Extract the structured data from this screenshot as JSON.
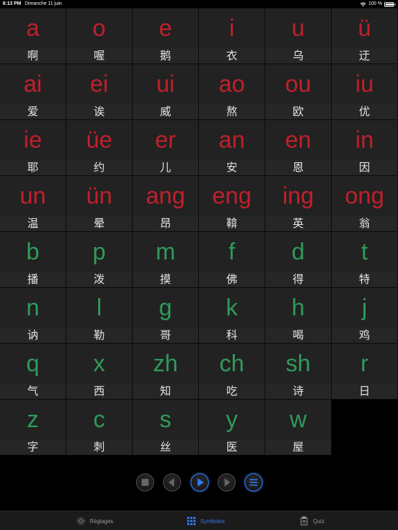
{
  "status_bar": {
    "time": "6:13 PM",
    "date": "Dimanche 11 juin",
    "battery": "100 %",
    "battery_level": 1.0
  },
  "colors": {
    "vowel": "#c0202b",
    "consonant": "#2f9a5a",
    "accent": "#2f7cf6"
  },
  "grid": {
    "rows": [
      [
        {
          "symbol": "a",
          "char": "啊",
          "kind": "vowel"
        },
        {
          "symbol": "o",
          "char": "喔",
          "kind": "vowel"
        },
        {
          "symbol": "e",
          "char": "鹅",
          "kind": "vowel"
        },
        {
          "symbol": "i",
          "char": "衣",
          "kind": "vowel"
        },
        {
          "symbol": "u",
          "char": "乌",
          "kind": "vowel"
        },
        {
          "symbol": "ü",
          "char": "迂",
          "kind": "vowel"
        }
      ],
      [
        {
          "symbol": "ai",
          "char": "爱",
          "kind": "vowel"
        },
        {
          "symbol": "ei",
          "char": "诶",
          "kind": "vowel"
        },
        {
          "symbol": "ui",
          "char": "威",
          "kind": "vowel"
        },
        {
          "symbol": "ao",
          "char": "熬",
          "kind": "vowel"
        },
        {
          "symbol": "ou",
          "char": "欧",
          "kind": "vowel"
        },
        {
          "symbol": "iu",
          "char": "优",
          "kind": "vowel"
        }
      ],
      [
        {
          "symbol": "ie",
          "char": "耶",
          "kind": "vowel"
        },
        {
          "symbol": "üe",
          "char": "约",
          "kind": "vowel"
        },
        {
          "symbol": "er",
          "char": "儿",
          "kind": "vowel"
        },
        {
          "symbol": "an",
          "char": "安",
          "kind": "vowel"
        },
        {
          "symbol": "en",
          "char": "恩",
          "kind": "vowel"
        },
        {
          "symbol": "in",
          "char": "因",
          "kind": "vowel"
        }
      ],
      [
        {
          "symbol": "un",
          "char": "温",
          "kind": "vowel"
        },
        {
          "symbol": "ün",
          "char": "晕",
          "kind": "vowel"
        },
        {
          "symbol": "ang",
          "char": "昂",
          "kind": "vowel"
        },
        {
          "symbol": "eng",
          "char": "鞥",
          "kind": "vowel"
        },
        {
          "symbol": "ing",
          "char": "英",
          "kind": "vowel"
        },
        {
          "symbol": "ong",
          "char": "翁",
          "kind": "vowel"
        }
      ],
      [
        {
          "symbol": "b",
          "char": "播",
          "kind": "consonant"
        },
        {
          "symbol": "p",
          "char": "泼",
          "kind": "consonant"
        },
        {
          "symbol": "m",
          "char": "摸",
          "kind": "consonant"
        },
        {
          "symbol": "f",
          "char": "佛",
          "kind": "consonant"
        },
        {
          "symbol": "d",
          "char": "得",
          "kind": "consonant"
        },
        {
          "symbol": "t",
          "char": "特",
          "kind": "consonant"
        }
      ],
      [
        {
          "symbol": "n",
          "char": "讷",
          "kind": "consonant"
        },
        {
          "symbol": "l",
          "char": "勒",
          "kind": "consonant"
        },
        {
          "symbol": "g",
          "char": "哥",
          "kind": "consonant"
        },
        {
          "symbol": "k",
          "char": "科",
          "kind": "consonant"
        },
        {
          "symbol": "h",
          "char": "喝",
          "kind": "consonant"
        },
        {
          "symbol": "j",
          "char": "鸡",
          "kind": "consonant"
        }
      ],
      [
        {
          "symbol": "q",
          "char": "气",
          "kind": "consonant"
        },
        {
          "symbol": "x",
          "char": "西",
          "kind": "consonant"
        },
        {
          "symbol": "zh",
          "char": "知",
          "kind": "consonant"
        },
        {
          "symbol": "ch",
          "char": "吃",
          "kind": "consonant"
        },
        {
          "symbol": "sh",
          "char": "诗",
          "kind": "consonant"
        },
        {
          "symbol": "r",
          "char": "日",
          "kind": "consonant"
        }
      ],
      [
        {
          "symbol": "z",
          "char": "字",
          "kind": "consonant"
        },
        {
          "symbol": "c",
          "char": "刺",
          "kind": "consonant"
        },
        {
          "symbol": "s",
          "char": "丝",
          "kind": "consonant"
        },
        {
          "symbol": "y",
          "char": "医",
          "kind": "consonant"
        },
        {
          "symbol": "w",
          "char": "屋",
          "kind": "consonant"
        }
      ]
    ]
  },
  "controls": [
    {
      "name": "stop-button",
      "icon": "stop-icon",
      "active": false
    },
    {
      "name": "previous-button",
      "icon": "previous-icon",
      "active": false
    },
    {
      "name": "play-button",
      "icon": "play-icon",
      "active": true
    },
    {
      "name": "next-button",
      "icon": "next-icon",
      "active": false
    },
    {
      "name": "list-button",
      "icon": "list-icon",
      "active": true
    }
  ],
  "tabbar": {
    "tabs": [
      {
        "name": "tab-reglages",
        "label": "Réglages",
        "icon": "gear-icon",
        "active": false
      },
      {
        "name": "tab-symboles",
        "label": "Symboles",
        "icon": "grid-icon",
        "active": true
      },
      {
        "name": "tab-quiz",
        "label": "Quiz",
        "icon": "clipboard-icon",
        "active": false
      }
    ]
  }
}
